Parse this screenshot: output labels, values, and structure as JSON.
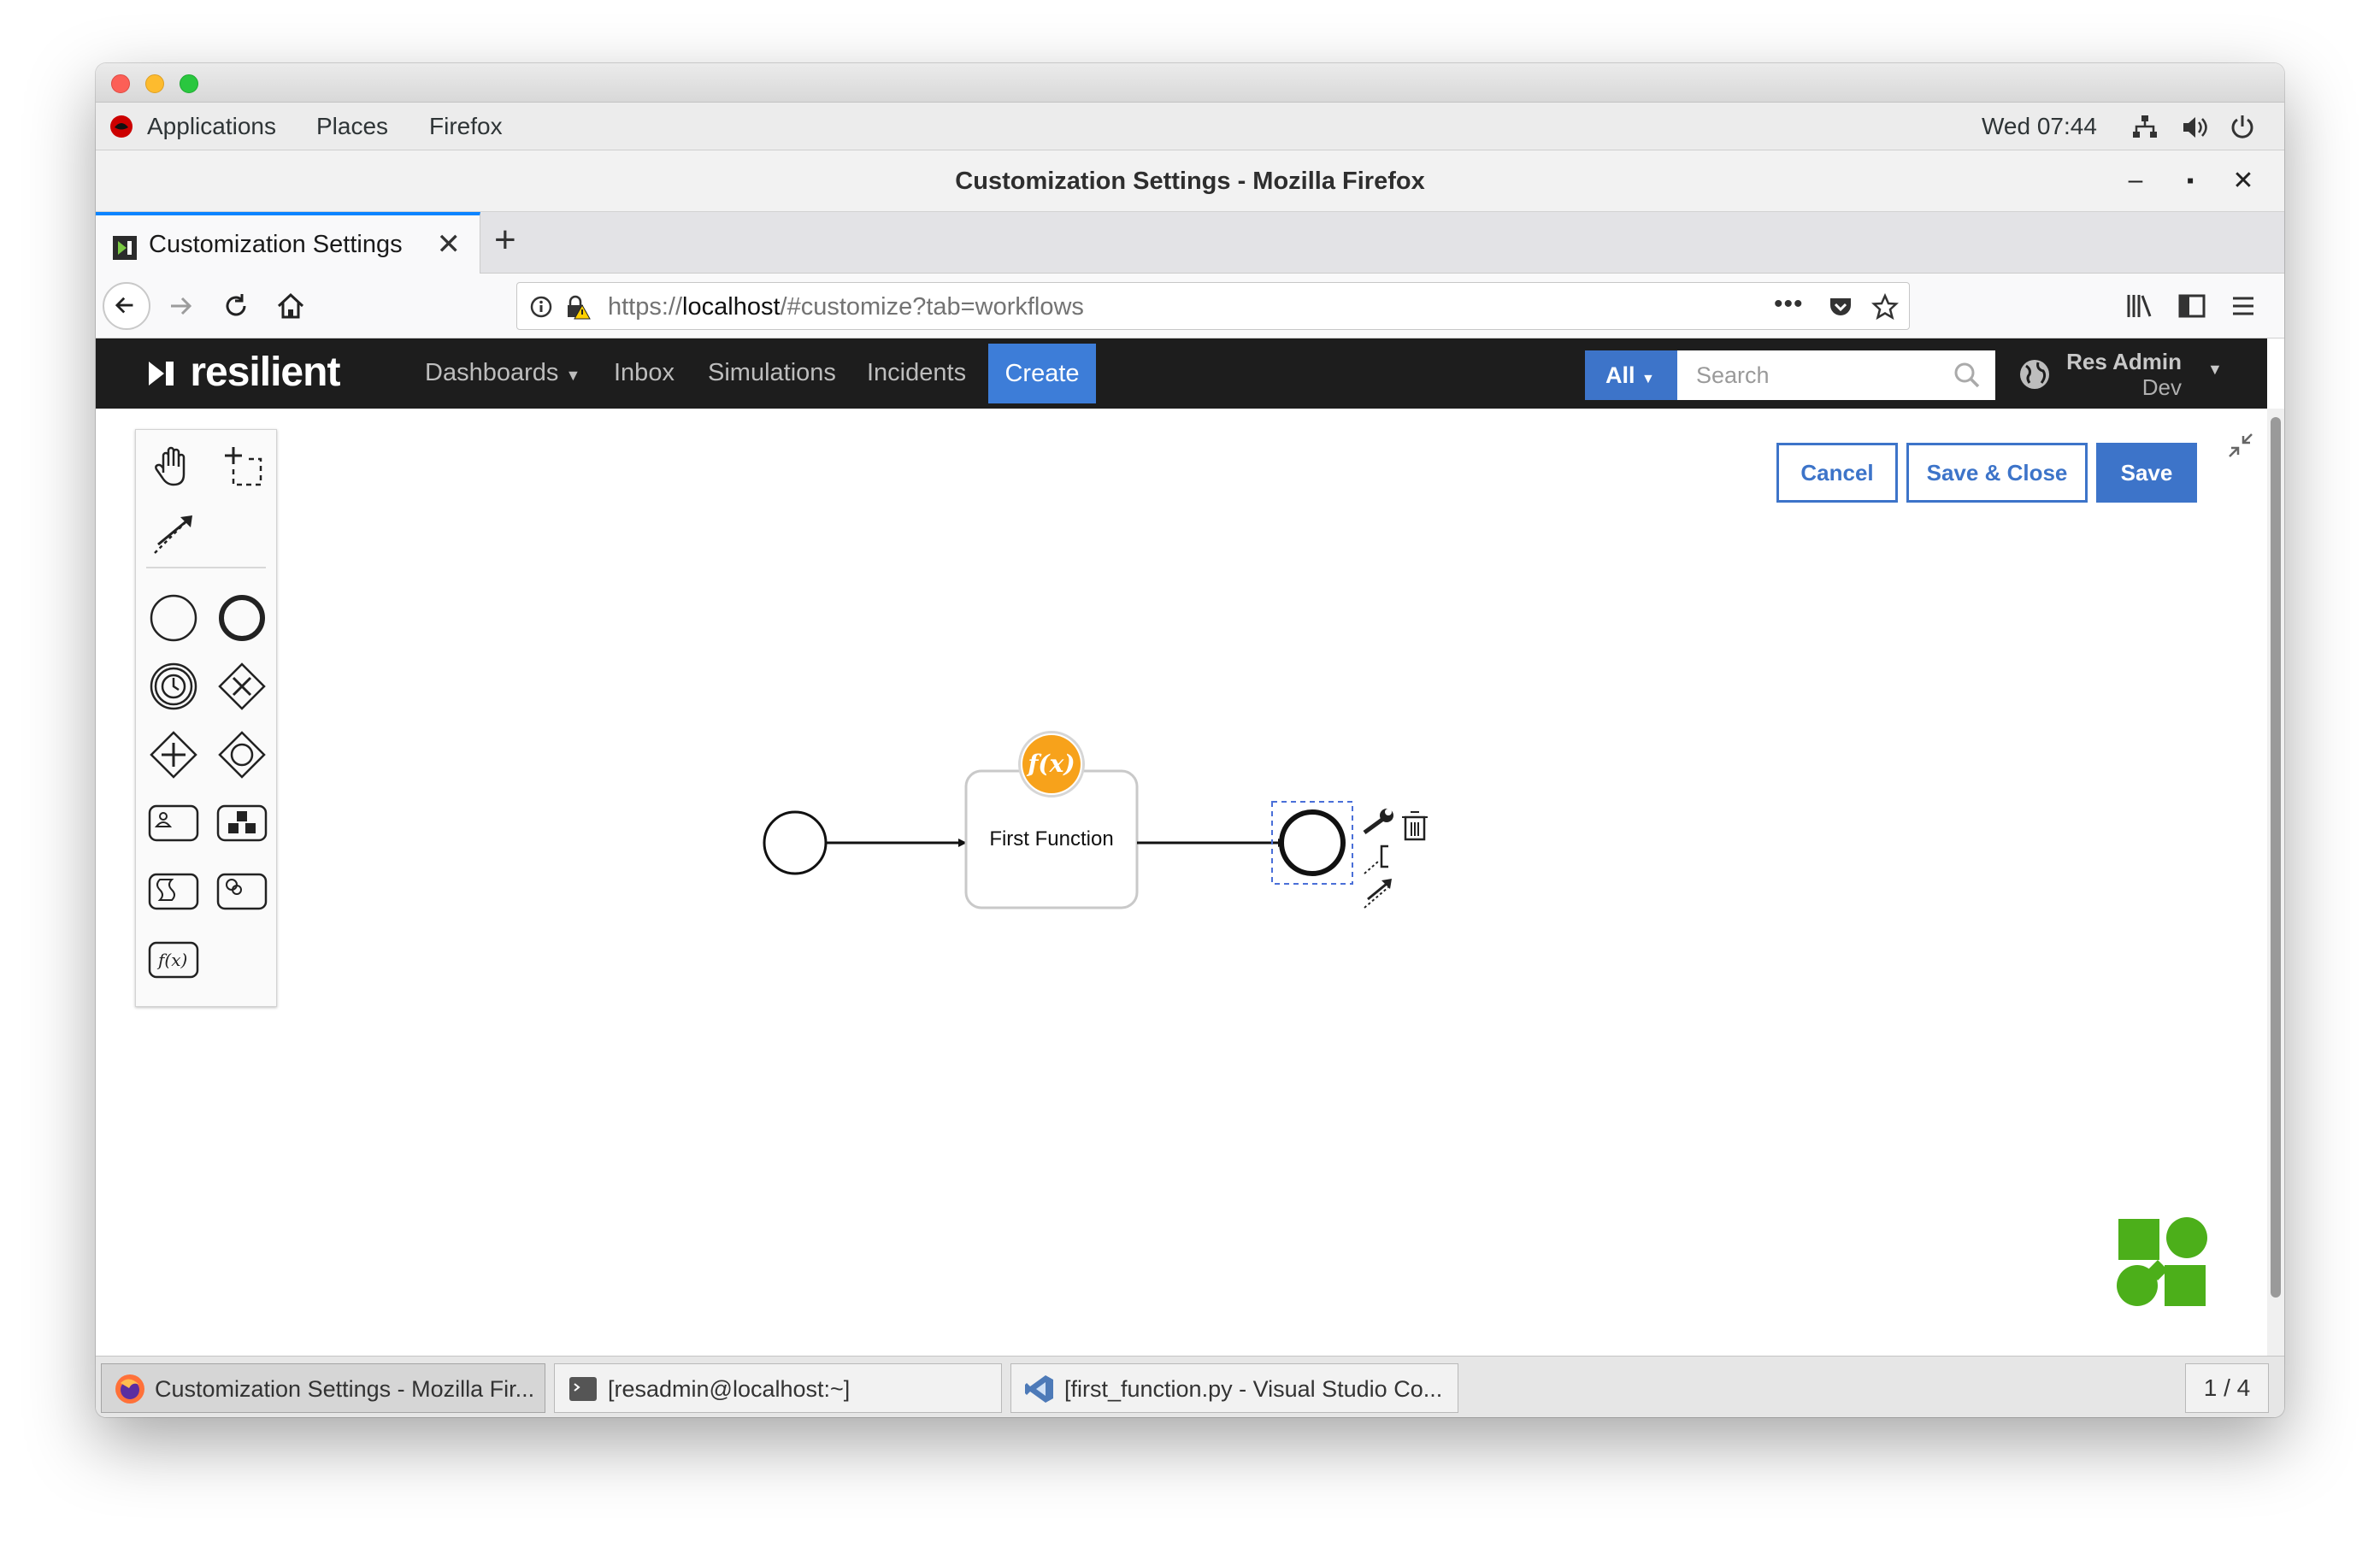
{
  "system_bar": {
    "menus": [
      "Applications",
      "Places",
      "Firefox"
    ],
    "clock": "Wed 07:44"
  },
  "window": {
    "title": "Customization Settings - Mozilla Firefox"
  },
  "browser": {
    "tab_label": "Customization Settings",
    "url_prefix": "https://",
    "url_host": "localhost",
    "url_path": "/#customize?tab=workflows"
  },
  "app": {
    "logo": "resilient",
    "nav": [
      "Dashboards",
      "Inbox",
      "Simulations",
      "Incidents"
    ],
    "create_label": "Create",
    "search_scope": "All",
    "search_placeholder": "Search",
    "user_name": "Res Admin",
    "user_org": "Dev"
  },
  "editor": {
    "cancel_label": "Cancel",
    "save_close_label": "Save & Close",
    "save_label": "Save",
    "task_label": "First Function",
    "function_badge": "f(x)",
    "palette_function_label": "f(x)"
  },
  "taskbar": {
    "items": [
      "Customization Settings - Mozilla Fir...",
      "[resadmin@localhost:~]",
      "[first_function.py - Visual Studio Co..."
    ],
    "pager": "1 / 4"
  },
  "colors": {
    "accent": "#3d74c9",
    "app_header": "#1d1d1d",
    "function_badge": "#f7a21b",
    "logo_green": "#4caf1a"
  }
}
